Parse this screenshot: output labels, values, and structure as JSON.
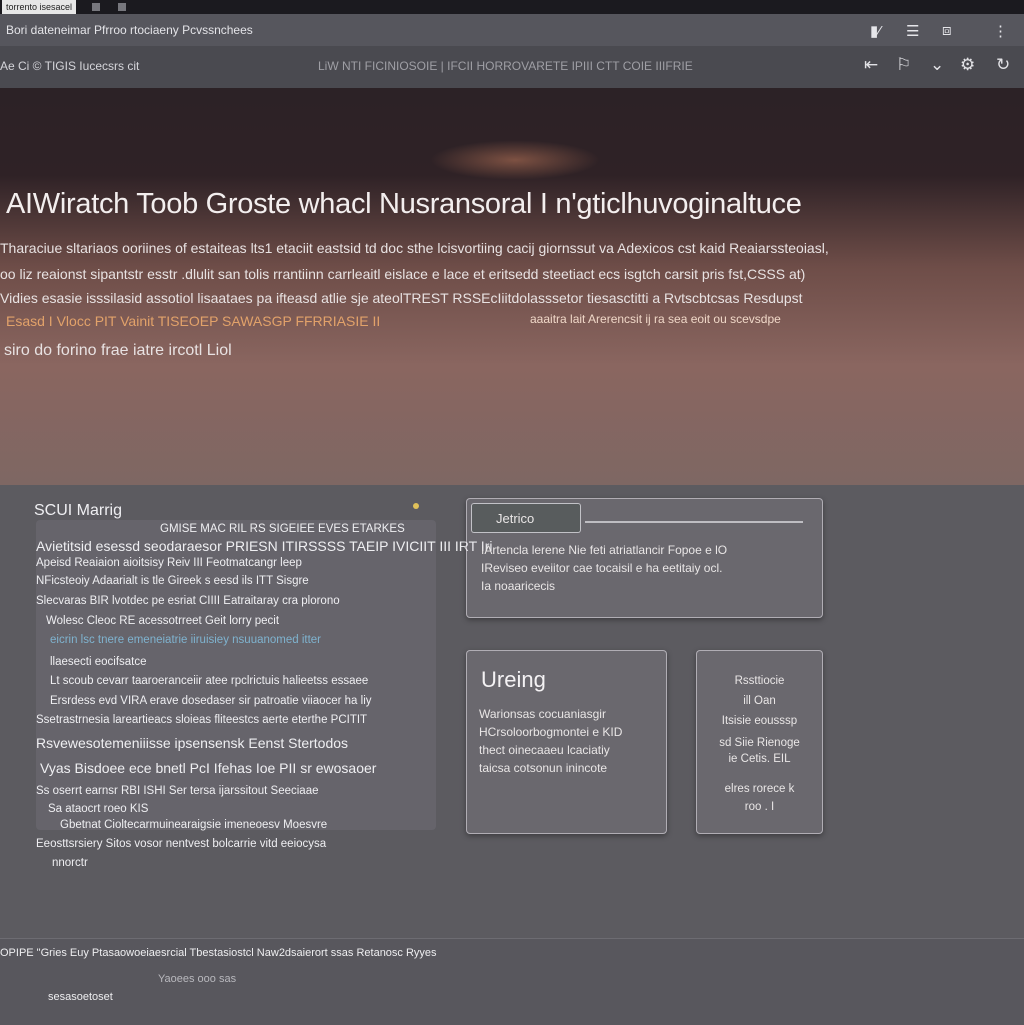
{
  "browser": {
    "tab_title": "torrento isesacel",
    "address": "Bori dateneimar Pfrroo rtociaeny Pcvssnchees",
    "icons": [
      "bookmark-icon",
      "reader-icon",
      "screenshot-icon",
      "menu-dots-icon"
    ]
  },
  "toolbar": {
    "left_text": "Ae   Ci   ©   TIGIS Iucecsrs   cit",
    "center_text": "LiW   NTI FICINIOSOIE   |  IFCII HORROVARETE   IPIII CTT COIE IIIFRIE",
    "icons": [
      "arrow-left-icon",
      "flag-icon",
      "chevron-icon",
      "settings-icon",
      "refresh-icon"
    ]
  },
  "hero": {
    "title": "AIWiratch Toob Groste whacl Nusransoral I n'gticlhuvoginaltuce",
    "lines": [
      "Tharaciue sltariaos ooriines of estaiteas lts1 etaciit eastsid td doc sthe lcisvortiing cacij giornssut va Adexicos cst kaid Reaiarssteoiasl,",
      "oo liz reaionst sipantstr esstr .dlulit san tolis rrantiinn carrleaitl eislace e lace et eritsedd  steetiact ecs isgtch carsit pris fst,CSSS at)",
      "Vidies esasie isssilasid  assotiol lisaataes pa ifteasd atlie sje  ateolTREST RSSEcIiitdolasssetor   tiesasctitti a Rvtscbtcsas Resdupst",
      "Esasd I Vlocc PIT   Vainit TISEOEP  SAWASGP FFRRIASIE II",
      "siro do forino frae iatre ircotl Liol"
    ],
    "orange_tail": "aaaitra    lait   Arerencsit ij ra   sea    eoit    ou scevsdpe"
  },
  "left_panel": {
    "title": "SCUI Marrig",
    "lines": [
      "GMISE MAC  RIL RS SIGEIEE EVES    ETARKES",
      "Avietitsid esessd  seodaraesor  PRIESN ITIRSSSS TAEIP IVICIIT III  IRT Iri",
      "Apeisd Reaiaion aioitsisy   Reiv III  Feotmatcangr    leep",
      "NFicsteoiy  Adaarialt  is tle Gireek     s eesd ils   ITT  Sisgre",
      "Slecvaras  BIR lvotdec pe esriat CIIII   Eatraitaray cra plorono",
      "Wolesc Cleoc RE  acessotrreet Geit      lorry pecit",
      "eicrin lsc tnere    emeneiatrie iiruisiey    nsuuanomed itter",
      "llaesecti  eocifsatce",
      "Lt scoub  cevarr   taaroeranceiir atee  rpclrictuis  halieetss essaee",
      "Ersrdess evd VIRA  erave dosedaser sir patroatie viiaocer ha liy",
      "Ssetrastrnesia lareartieacs sloieas  fliteestcs   aerte eterthe PCITIT",
      "Rsvewesotemeniiisse    ipsensensk     Eenst Stertodos",
      "Vyas Bisdoee ece bnetl PcI Ifehas Ioe  PII   sr ewosaoer",
      "Ss oserrt  earnsr  RBI ISHI Ser   tersa ijarssitout Seeciaae",
      "Sa ataocrt roeo    KIS",
      "Gbetnat Cioltecarmuinearaigsie  imeneoesv  Moesvre",
      "Eeosttsrsiery    Sitos  vosor  nentvest  bolcarrie  vitd  eeiocysa",
      "nnorctr"
    ]
  },
  "info_card": {
    "tag": "Jetrico",
    "lines": [
      "IArtencla lerene Nie feti atriatlancir Fopoe e lO",
      "IReviseo eveiitor cae tocaisil e ha eetitaiy ocl.",
      "Ia noaaricecis"
    ]
  },
  "pricing_card": {
    "heading": "Ureing",
    "lines": [
      "Warionsas  cocuaniasgir",
      "HCrsoloorbogmontei   e KID",
      "thect oinecaaeu lcaciatiy",
      "taicsa cotsonun inincote"
    ]
  },
  "small_card": {
    "lines": [
      "Rssttiocie",
      "ill Oan",
      "Itsisie   eousssp",
      "sd  Siie   Rienoge",
      "ie   Cetis. EIL",
      "elres  rorece  k",
      "roo . I"
    ]
  },
  "footer": {
    "line1": "OPIPE  \"Gries  Euy Ptasaowoeiaesrcial Tbestasiostcl Naw2dsaierort   ssas  Retanosc   Ryyes",
    "line2": "Yaoees        ooo  sas",
    "line3": "sesasoetoset"
  }
}
